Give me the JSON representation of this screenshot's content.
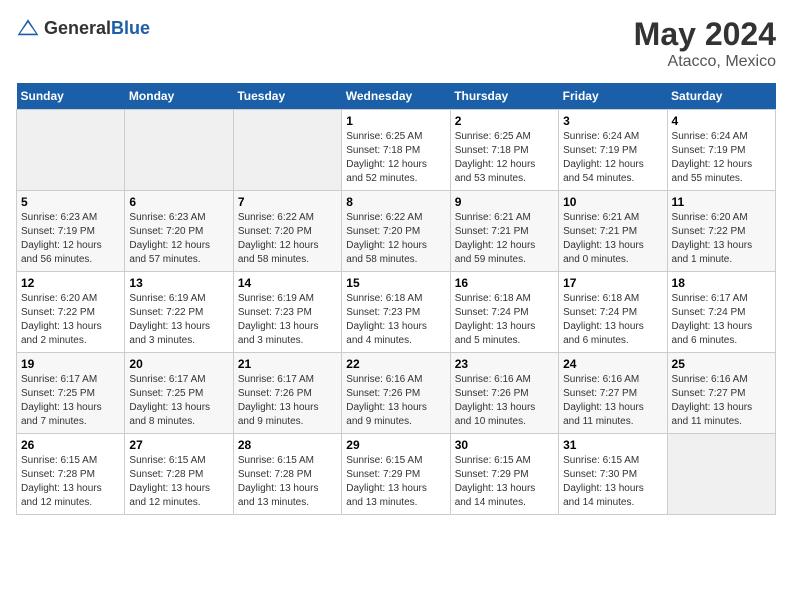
{
  "header": {
    "logo_general": "General",
    "logo_blue": "Blue",
    "month": "May 2024",
    "location": "Atacco, Mexico"
  },
  "weekdays": [
    "Sunday",
    "Monday",
    "Tuesday",
    "Wednesday",
    "Thursday",
    "Friday",
    "Saturday"
  ],
  "weeks": [
    [
      {
        "day": "",
        "info": ""
      },
      {
        "day": "",
        "info": ""
      },
      {
        "day": "",
        "info": ""
      },
      {
        "day": "1",
        "info": "Sunrise: 6:25 AM\nSunset: 7:18 PM\nDaylight: 12 hours\nand 52 minutes."
      },
      {
        "day": "2",
        "info": "Sunrise: 6:25 AM\nSunset: 7:18 PM\nDaylight: 12 hours\nand 53 minutes."
      },
      {
        "day": "3",
        "info": "Sunrise: 6:24 AM\nSunset: 7:19 PM\nDaylight: 12 hours\nand 54 minutes."
      },
      {
        "day": "4",
        "info": "Sunrise: 6:24 AM\nSunset: 7:19 PM\nDaylight: 12 hours\nand 55 minutes."
      }
    ],
    [
      {
        "day": "5",
        "info": "Sunrise: 6:23 AM\nSunset: 7:19 PM\nDaylight: 12 hours\nand 56 minutes."
      },
      {
        "day": "6",
        "info": "Sunrise: 6:23 AM\nSunset: 7:20 PM\nDaylight: 12 hours\nand 57 minutes."
      },
      {
        "day": "7",
        "info": "Sunrise: 6:22 AM\nSunset: 7:20 PM\nDaylight: 12 hours\nand 58 minutes."
      },
      {
        "day": "8",
        "info": "Sunrise: 6:22 AM\nSunset: 7:20 PM\nDaylight: 12 hours\nand 58 minutes."
      },
      {
        "day": "9",
        "info": "Sunrise: 6:21 AM\nSunset: 7:21 PM\nDaylight: 12 hours\nand 59 minutes."
      },
      {
        "day": "10",
        "info": "Sunrise: 6:21 AM\nSunset: 7:21 PM\nDaylight: 13 hours\nand 0 minutes."
      },
      {
        "day": "11",
        "info": "Sunrise: 6:20 AM\nSunset: 7:22 PM\nDaylight: 13 hours\nand 1 minute."
      }
    ],
    [
      {
        "day": "12",
        "info": "Sunrise: 6:20 AM\nSunset: 7:22 PM\nDaylight: 13 hours\nand 2 minutes."
      },
      {
        "day": "13",
        "info": "Sunrise: 6:19 AM\nSunset: 7:22 PM\nDaylight: 13 hours\nand 3 minutes."
      },
      {
        "day": "14",
        "info": "Sunrise: 6:19 AM\nSunset: 7:23 PM\nDaylight: 13 hours\nand 3 minutes."
      },
      {
        "day": "15",
        "info": "Sunrise: 6:18 AM\nSunset: 7:23 PM\nDaylight: 13 hours\nand 4 minutes."
      },
      {
        "day": "16",
        "info": "Sunrise: 6:18 AM\nSunset: 7:24 PM\nDaylight: 13 hours\nand 5 minutes."
      },
      {
        "day": "17",
        "info": "Sunrise: 6:18 AM\nSunset: 7:24 PM\nDaylight: 13 hours\nand 6 minutes."
      },
      {
        "day": "18",
        "info": "Sunrise: 6:17 AM\nSunset: 7:24 PM\nDaylight: 13 hours\nand 6 minutes."
      }
    ],
    [
      {
        "day": "19",
        "info": "Sunrise: 6:17 AM\nSunset: 7:25 PM\nDaylight: 13 hours\nand 7 minutes."
      },
      {
        "day": "20",
        "info": "Sunrise: 6:17 AM\nSunset: 7:25 PM\nDaylight: 13 hours\nand 8 minutes."
      },
      {
        "day": "21",
        "info": "Sunrise: 6:17 AM\nSunset: 7:26 PM\nDaylight: 13 hours\nand 9 minutes."
      },
      {
        "day": "22",
        "info": "Sunrise: 6:16 AM\nSunset: 7:26 PM\nDaylight: 13 hours\nand 9 minutes."
      },
      {
        "day": "23",
        "info": "Sunrise: 6:16 AM\nSunset: 7:26 PM\nDaylight: 13 hours\nand 10 minutes."
      },
      {
        "day": "24",
        "info": "Sunrise: 6:16 AM\nSunset: 7:27 PM\nDaylight: 13 hours\nand 11 minutes."
      },
      {
        "day": "25",
        "info": "Sunrise: 6:16 AM\nSunset: 7:27 PM\nDaylight: 13 hours\nand 11 minutes."
      }
    ],
    [
      {
        "day": "26",
        "info": "Sunrise: 6:15 AM\nSunset: 7:28 PM\nDaylight: 13 hours\nand 12 minutes."
      },
      {
        "day": "27",
        "info": "Sunrise: 6:15 AM\nSunset: 7:28 PM\nDaylight: 13 hours\nand 12 minutes."
      },
      {
        "day": "28",
        "info": "Sunrise: 6:15 AM\nSunset: 7:28 PM\nDaylight: 13 hours\nand 13 minutes."
      },
      {
        "day": "29",
        "info": "Sunrise: 6:15 AM\nSunset: 7:29 PM\nDaylight: 13 hours\nand 13 minutes."
      },
      {
        "day": "30",
        "info": "Sunrise: 6:15 AM\nSunset: 7:29 PM\nDaylight: 13 hours\nand 14 minutes."
      },
      {
        "day": "31",
        "info": "Sunrise: 6:15 AM\nSunset: 7:30 PM\nDaylight: 13 hours\nand 14 minutes."
      },
      {
        "day": "",
        "info": ""
      }
    ]
  ]
}
